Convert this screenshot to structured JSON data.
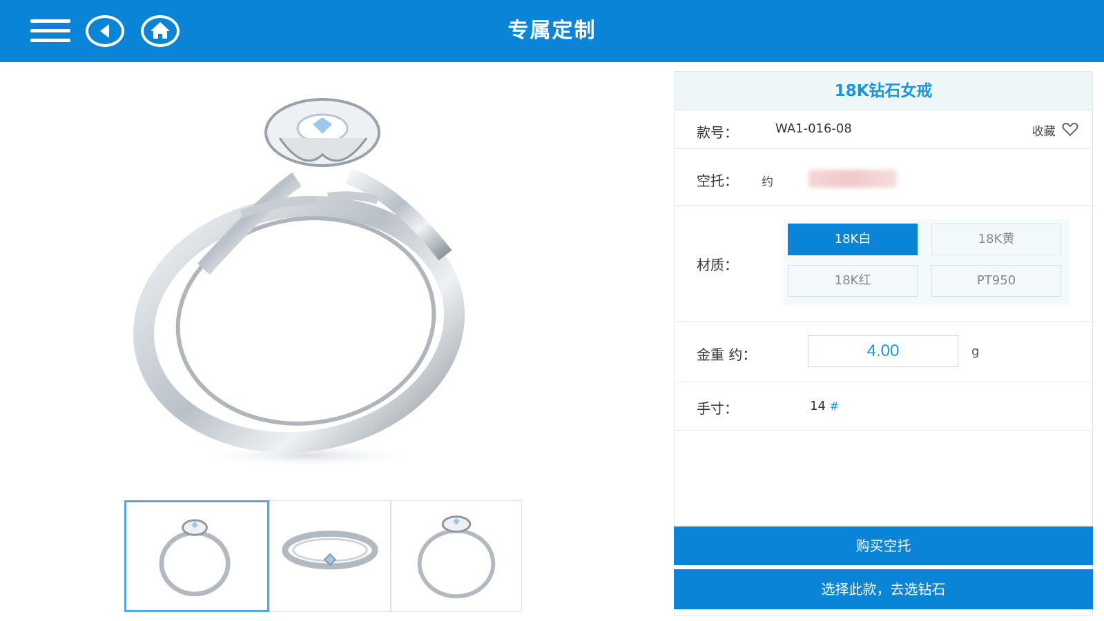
{
  "header": {
    "title": "专属定制",
    "menu_icon": "menu-icon",
    "back_icon": "back-arrow-icon",
    "home_icon": "home-icon"
  },
  "colors": {
    "brand_blue": "#0a84d6",
    "title_blue": "#1996e0",
    "panel_header_bg": "#eef6f7"
  },
  "gallery": {
    "main_image": "ring-main-image",
    "thumbnails": [
      "ring-front-view",
      "ring-top-view",
      "ring-side-view"
    ],
    "selected_index": 0
  },
  "product": {
    "name": "18K钻石女戒",
    "style_label": "款号：",
    "style_value": "WA1-016-08",
    "favorite_label": "收藏",
    "setting_label": "空托：",
    "setting_unit": "约",
    "material_label": "材质：",
    "materials": [
      "18K白",
      "18K黄",
      "18K红",
      "PT950"
    ],
    "selected_material": "18K白",
    "weight_label": "金重 约：",
    "weight_value": "4.00",
    "weight_unit": "g",
    "size_label": "手寸：",
    "size_value": "14",
    "size_unit": "#"
  },
  "actions": {
    "buy_setting": "购买空托",
    "choose_diamond": "选择此款，去选钻石"
  }
}
